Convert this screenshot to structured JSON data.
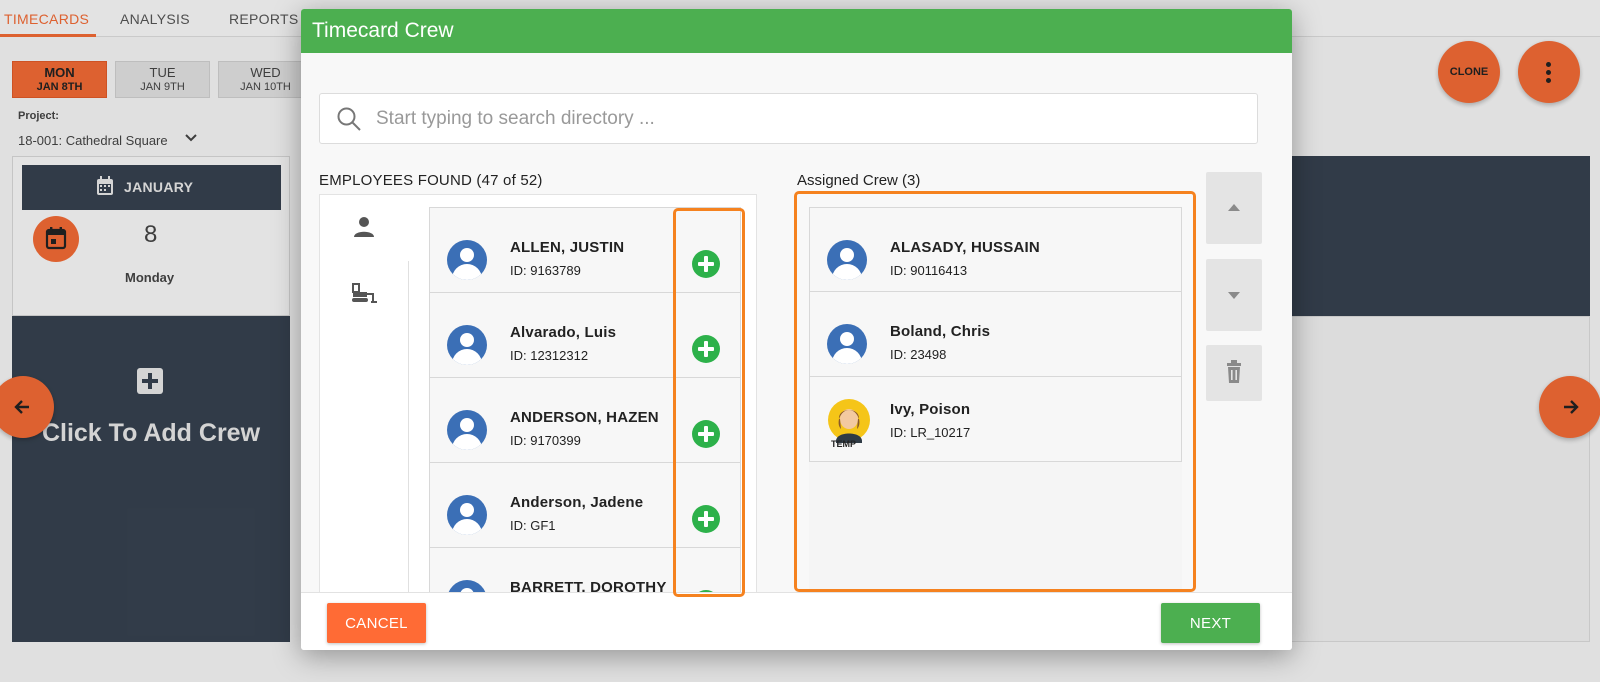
{
  "app": {
    "tabs": [
      {
        "label": "TIMECARDS",
        "active": true
      },
      {
        "label": "ANALYSIS",
        "active": false
      },
      {
        "label": "REPORTS",
        "active": false
      }
    ],
    "days": [
      {
        "day": "MON",
        "date": "JAN 8TH",
        "active": true
      },
      {
        "day": "TUE",
        "date": "JAN 9TH",
        "active": false
      },
      {
        "day": "WED",
        "date": "JAN 10TH",
        "active": false
      }
    ],
    "project_label": "Project:",
    "project_value": "18-001: Cathedral Square",
    "clone_label": "CLONE",
    "calendar": {
      "month": "JANUARY",
      "day_number": "8",
      "weekday": "Monday"
    },
    "add_crew_text": "Click To Add Crew",
    "accent_color": "#f06a35",
    "dark_panel_color": "#36414f"
  },
  "modal": {
    "title": "Timecard Crew",
    "header_color": "#4caf50",
    "search_placeholder": "Start typing to search directory ...",
    "employees_found_label": "EMPLOYEES FOUND (47 of 52)",
    "assigned_crew_label": "Assigned Crew (3)",
    "employees": [
      {
        "name": "ALLEN, JUSTIN",
        "id": "ID: 9163789"
      },
      {
        "name": "Alvarado, Luis",
        "id": "ID: 12312312"
      },
      {
        "name": "ANDERSON, HAZEN",
        "id": "ID: 9170399"
      },
      {
        "name": "Anderson, Jadene",
        "id": "ID: GF1"
      },
      {
        "name": "BARRETT, DOROTHY",
        "id": ""
      }
    ],
    "assigned_crew": [
      {
        "name": "ALASADY, HUSSAIN",
        "id": "ID: 90116413",
        "avatar": "person-icon"
      },
      {
        "name": "Boland, Chris",
        "id": "ID: 23498",
        "avatar": "person-icon"
      },
      {
        "name": "Ivy, Poison",
        "id": "ID: LR_10217",
        "avatar": "temp-worker-icon",
        "badge": "TEMP"
      }
    ],
    "cancel_label": "CANCEL",
    "next_label": "NEXT",
    "highlight_color": "#f5821f"
  }
}
